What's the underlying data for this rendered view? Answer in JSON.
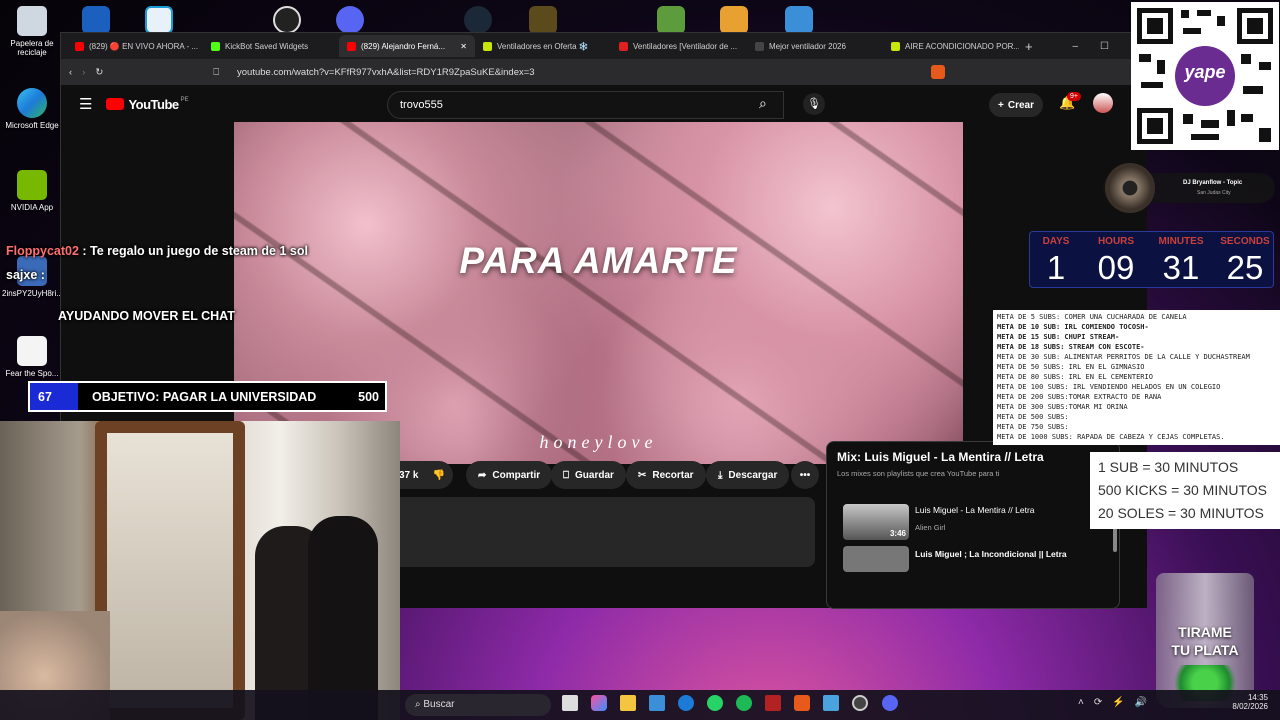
{
  "desktop_icons": [
    {
      "label": "Papelera de reciclaje",
      "name": "recycle-bin-icon"
    },
    {
      "label": "Microsoft Edge",
      "name": "edge-icon"
    },
    {
      "label": "NVIDIA App",
      "name": "nvidia-icon"
    },
    {
      "label": "2insPY2UyH8ri...",
      "name": "file-icon"
    },
    {
      "label": "Fear the Spo...",
      "name": "document-icon"
    }
  ],
  "browser": {
    "tabs": [
      "(829) 🔴 EN VIVO AHORA - ...",
      "KickBot Saved Widgets",
      "(829) Alejandro Ferná...",
      "Ventiladores en Oferta ❄️",
      "Ventiladores [Ventilador de ...",
      "Mejor ventilador 2026",
      "AIRE ACONDICIONADO POR..."
    ],
    "tab_colors": [
      "#ff0000",
      "#53fc18",
      "#ff0000",
      "#c8e60a",
      "#e02020",
      "#444444",
      "#c8e60a"
    ],
    "url": "youtube.com/watch?v=KFfR977vxhA&list=RDY1R9ZpaSuKE&index=3"
  },
  "youtube": {
    "logo": "YouTube",
    "region": "PE",
    "search_value": "trovo555",
    "create_label": "Crear",
    "notif_badge": "9+",
    "video_title_overlay": "PARA AMARTE",
    "video_watermark": "honeylove",
    "likes": "37 k",
    "share": "Compartir",
    "save": "Guardar",
    "clip": "Recortar",
    "download": "Descargar",
    "mix_title": "Mix: Luis Miguel - La Mentira // Letra",
    "mix_sub": "Los mixes son playlists que crea YouTube para ti",
    "playlist": [
      {
        "title": "Luis Miguel - La Mentira // Letra",
        "channel": "Alien Girl",
        "duration": "3:46"
      },
      {
        "title": "Luis Miguel ; La Incondicional || Letra",
        "channel": "",
        "duration": ""
      }
    ]
  },
  "overlays": {
    "chat": [
      {
        "user": "Floppycat02",
        "msg": "Te regalo un juego de steam de 1 sol"
      },
      {
        "user": "sajxe",
        "msg": ""
      }
    ],
    "chat_notice": "AYUDANDO MOVER EL CHAT",
    "goal": {
      "current": "67",
      "label": "OBJETIVO: PAGAR LA UNIVERSIDAD",
      "target": "500",
      "progress": 0.134
    },
    "music": {
      "artist": "DJ Bryanflow - Topic",
      "sub": "San Judas City"
    },
    "timer": {
      "labels": [
        "DAYS",
        "HOURS",
        "MINUTES",
        "SECONDS"
      ],
      "values": [
        "1",
        "09",
        "31",
        "25"
      ]
    },
    "metas": [
      "META DE 5 SUBS: COMER UNA CUCHARADA DE CANELA",
      "META DE 10 SUB: IRL COMIENDO TOCOSH-",
      "META DE 15 SUB: CHUPI STREAM-",
      "META DE 18 SUBS: STREAM CON ESCOTE-",
      "META DE 30 SUB:  ALIMENTAR PERRITOS DE LA CALLE Y DUCHASTREAM",
      "META DE 50 SUBS: IRL EN EL GIMNASIO",
      "META DE 80 SUBS: IRL EN EL CEMENTERIO",
      "META DE 100 SUBS: IRL VENDIENDO HELADOS EN UN COLEGIO",
      "META DE 200 SUBS:TOMAR EXTRACTO DE RANA",
      "META DE 300 SUBS:TOMAR MI ORINA",
      "META DE 500 SUBS:",
      "META DE 750 SUBS:",
      "META DE 1000 SUBS: RAPADA DE CABEZA Y CEJAS COMPLETAS."
    ],
    "subs_rates": [
      "1 SUB = 30 MINUTOS",
      "500 KICKS = 30 MINUTOS",
      "20 SOLES = 30 MINUTOS"
    ],
    "jar_text": [
      "TIRAME",
      "TU PLATA"
    ],
    "qr_brand": "yape"
  },
  "taskbar": {
    "search": "Buscar",
    "time": "14:35",
    "date": "8/02/2026"
  }
}
